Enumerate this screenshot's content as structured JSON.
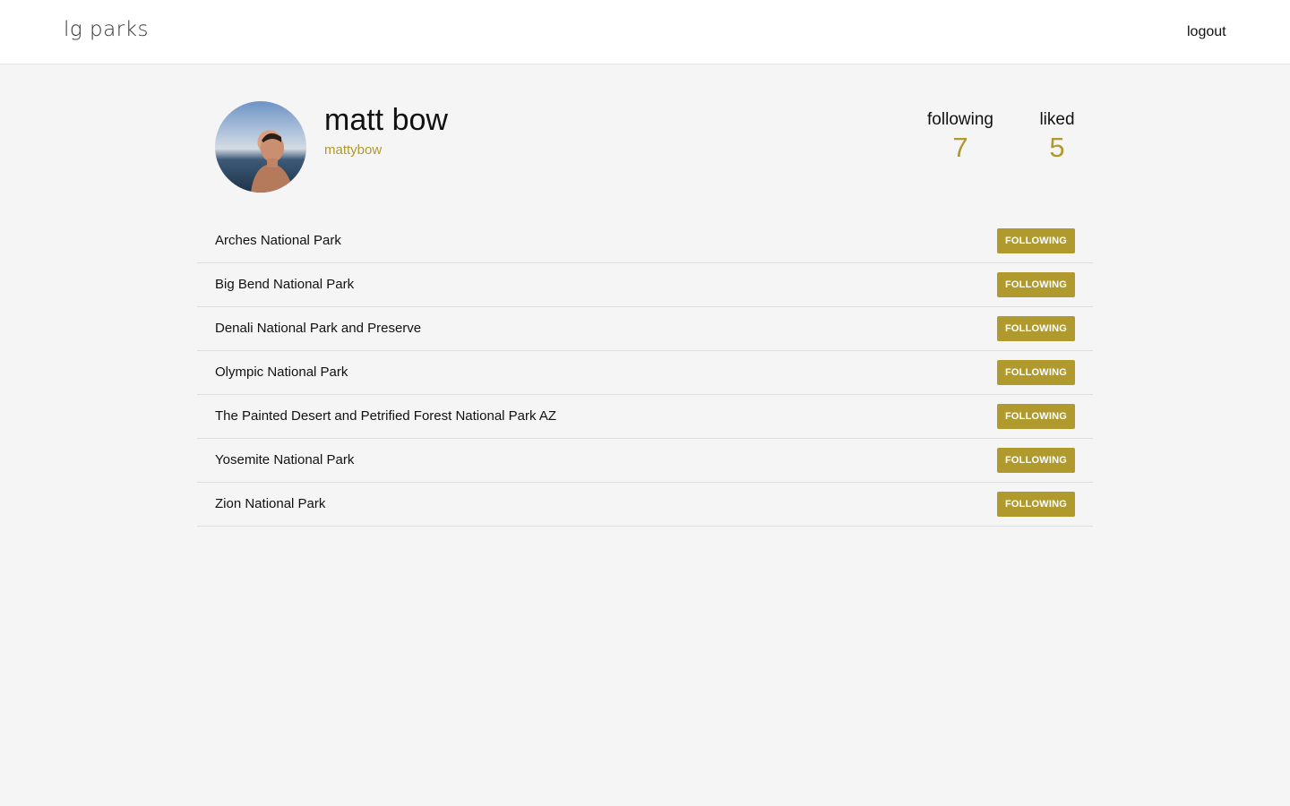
{
  "header": {
    "logo": "lg parks",
    "logout_label": "logout"
  },
  "profile": {
    "name": "matt bow",
    "username": "mattybow",
    "avatar": "profile-photo",
    "stats": {
      "following_label": "following",
      "following_count": "7",
      "liked_label": "liked",
      "liked_count": "5"
    }
  },
  "parks": [
    {
      "name": "Arches National Park",
      "button": "FOLLOWING"
    },
    {
      "name": "Big Bend National Park",
      "button": "FOLLOWING"
    },
    {
      "name": "Denali National Park and Preserve",
      "button": "FOLLOWING"
    },
    {
      "name": "Olympic National Park",
      "button": "FOLLOWING"
    },
    {
      "name": "The Painted Desert and Petrified Forest National Park AZ",
      "button": "FOLLOWING"
    },
    {
      "name": "Yosemite National Park",
      "button": "FOLLOWING"
    },
    {
      "name": "Zion National Park",
      "button": "FOLLOWING"
    }
  ],
  "colors": {
    "accent": "#b09a2e",
    "background": "#f5f5f5",
    "header_bg": "#ffffff"
  }
}
